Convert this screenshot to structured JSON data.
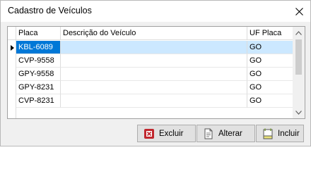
{
  "window": {
    "title": "Cadastro de Veículos"
  },
  "grid": {
    "columns": [
      "Placa",
      "Descrição do Veículo",
      "UF Placa"
    ],
    "rows": [
      {
        "placa": "KBL-6089",
        "descricao": "",
        "uf": "GO",
        "selected": true
      },
      {
        "placa": "CVP-9558",
        "descricao": "",
        "uf": "GO"
      },
      {
        "placa": "GPY-9558",
        "descricao": "",
        "uf": "GO"
      },
      {
        "placa": "GPY-8231",
        "descricao": "",
        "uf": "GO"
      },
      {
        "placa": "CVP-8231",
        "descricao": "",
        "uf": "GO"
      }
    ]
  },
  "buttons": {
    "excluir": "Excluir",
    "alterar": "Alterar",
    "incluir": "Incluir"
  },
  "icons": {
    "close": "close-icon",
    "row_indicator": "row-pointer-icon",
    "delete": "delete-icon",
    "edit": "document-edit-icon",
    "add": "document-add-icon"
  },
  "colors": {
    "selection": "#0078d7",
    "selection_light": "#cce8ff"
  }
}
